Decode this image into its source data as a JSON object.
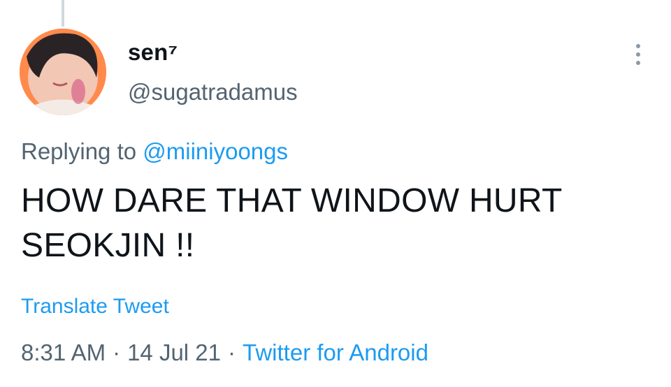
{
  "user": {
    "display_name": "sen⁷",
    "handle": "@sugatradamus"
  },
  "reply": {
    "prefix": "Replying to ",
    "mention": "@miiniyoongs"
  },
  "tweet": {
    "text_line1": "HOW DARE THAT WINDOW HURT",
    "text_line2": "SEOKJIN !!"
  },
  "translate_label": "Translate Tweet",
  "meta": {
    "time": "8:31 AM",
    "separator": "·",
    "date": "14 Jul 21",
    "source": "Twitter for Android"
  },
  "icons": {
    "more": "more-vertical-icon"
  },
  "colors": {
    "accent": "#1d9bf0",
    "secondary_text": "#536471",
    "primary_text": "#0f1419",
    "avatar_bg": "#ff8a4c"
  }
}
